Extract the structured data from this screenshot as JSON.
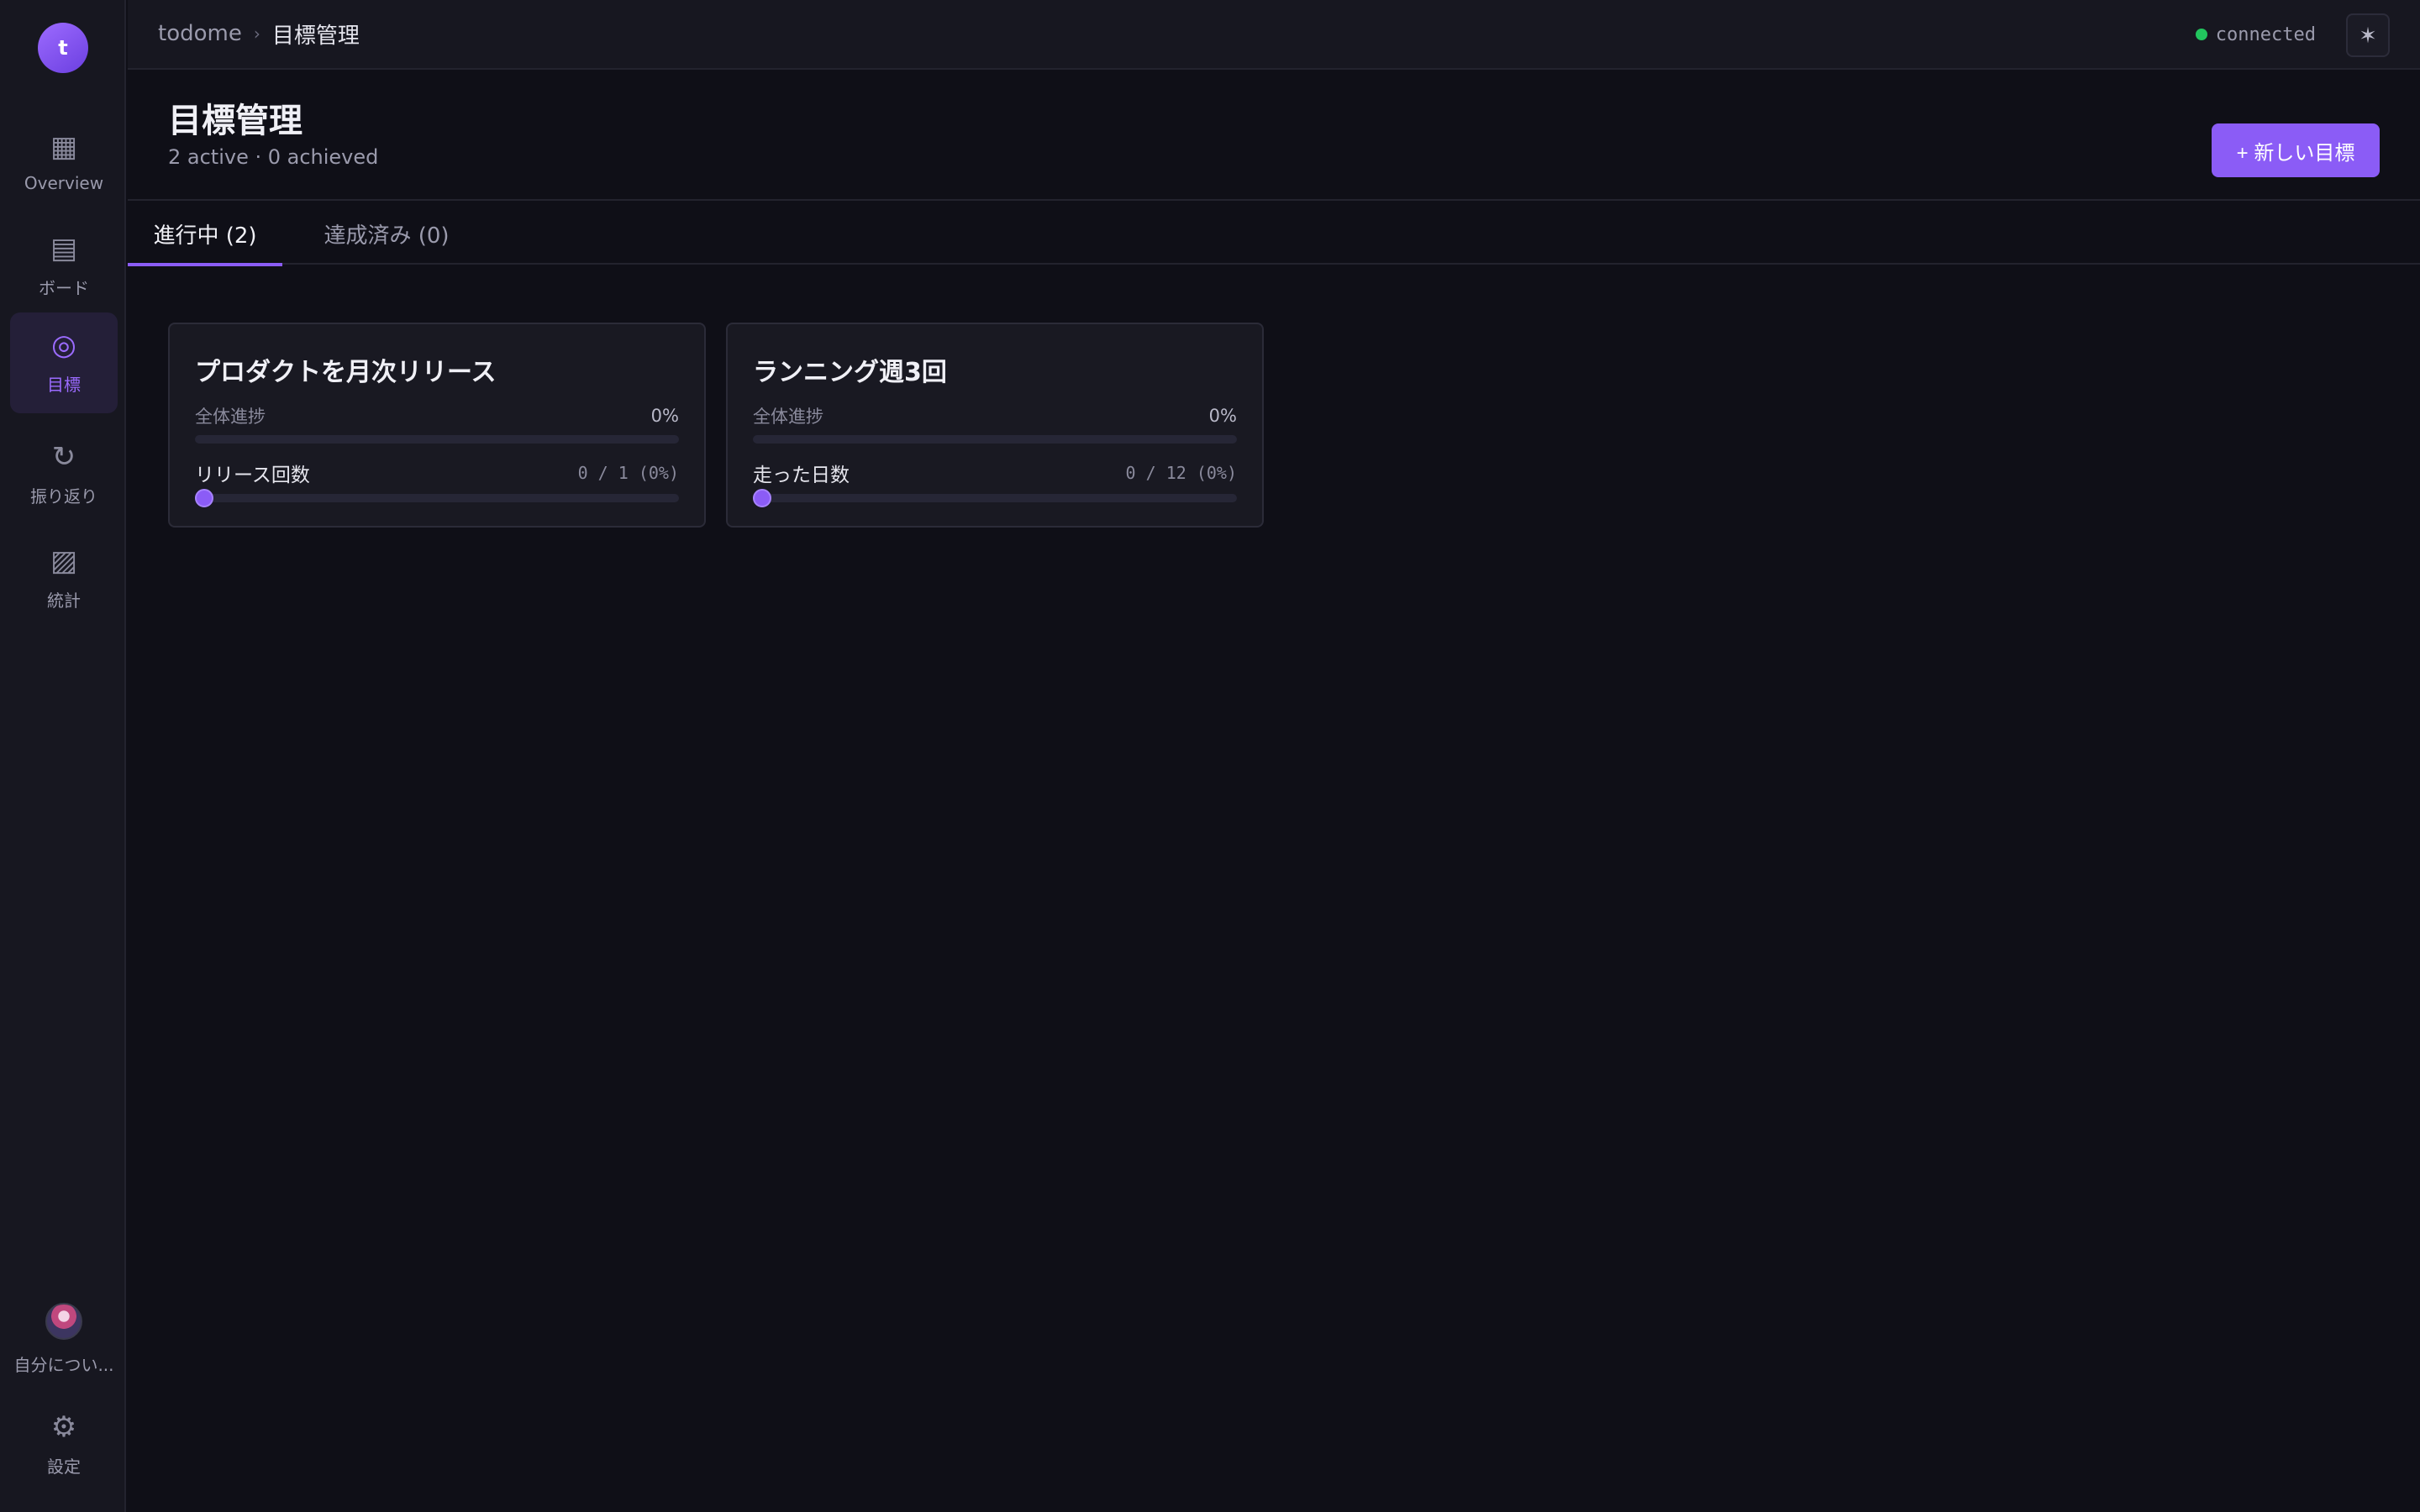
{
  "app": {
    "logo_letter": "t"
  },
  "sidebar": {
    "items": [
      {
        "label": "Overview",
        "icon": "grid-icon"
      },
      {
        "label": "ボード",
        "icon": "board-icon"
      },
      {
        "label": "目標",
        "icon": "target-icon",
        "active": true
      },
      {
        "label": "振り返り",
        "icon": "refresh-icon"
      },
      {
        "label": "統計",
        "icon": "stats-icon"
      }
    ],
    "profile_label": "自分につい...",
    "settings_label": "設定"
  },
  "topbar": {
    "breadcrumb_root": "todome",
    "breadcrumb_sep": "›",
    "breadcrumb_current": "目標管理",
    "status_text": "connected",
    "status_color": "#22c55e",
    "theme_icon": "✶"
  },
  "header": {
    "title": "目標管理",
    "subtitle": "2 active · 0 achieved",
    "new_button": "+ 新しい目標"
  },
  "tabs": [
    {
      "label": "進行中 (2)",
      "active": true
    },
    {
      "label": "達成済み (0)",
      "active": false
    }
  ],
  "goals": [
    {
      "title": "プロダクトを月次リリース",
      "overall_label": "全体進捗",
      "overall_value": "0%",
      "overall_progress": 0,
      "metric_label": "リリース回数",
      "metric_value": "0 / 1 (0%)",
      "metric_progress": 0
    },
    {
      "title": "ランニング週3回",
      "overall_label": "全体進捗",
      "overall_value": "0%",
      "overall_progress": 0,
      "metric_label": "走った日数",
      "metric_value": "0 / 12 (0%)",
      "metric_progress": 0
    }
  ],
  "accent_color": "#8b5cf6"
}
